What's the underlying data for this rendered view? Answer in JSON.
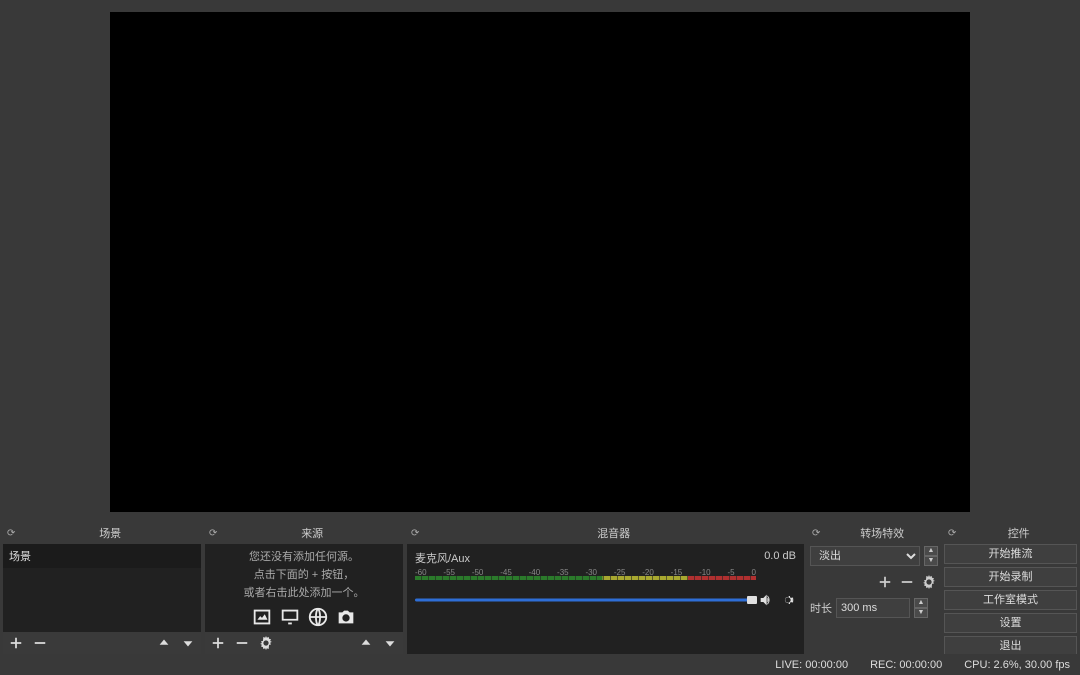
{
  "panels": {
    "scenes": {
      "title": "场景",
      "items": [
        "场景"
      ]
    },
    "sources": {
      "title": "来源",
      "empty_lines": [
        "您还没有添加任何源。",
        "点击下面的 + 按钮，",
        "或者右击此处添加一个。"
      ]
    },
    "mixer": {
      "title": "混音器",
      "tracks": [
        {
          "name": "麦克风/Aux",
          "db": "0.0 dB"
        }
      ],
      "ticks": [
        "-60",
        "-55",
        "-50",
        "-45",
        "-40",
        "-35",
        "-30",
        "-25",
        "-20",
        "-15",
        "-10",
        "-5",
        "0"
      ]
    },
    "transitions": {
      "title": "转场特效",
      "selected": "淡出",
      "duration_label": "时长",
      "duration_value": "300 ms"
    },
    "controls": {
      "title": "控件",
      "buttons": [
        "开始推流",
        "开始录制",
        "工作室模式",
        "设置",
        "退出"
      ]
    }
  },
  "status": {
    "live": "LIVE: 00:00:00",
    "rec": "REC: 00:00:00",
    "cpu": "CPU: 2.6%, 30.00 fps"
  }
}
